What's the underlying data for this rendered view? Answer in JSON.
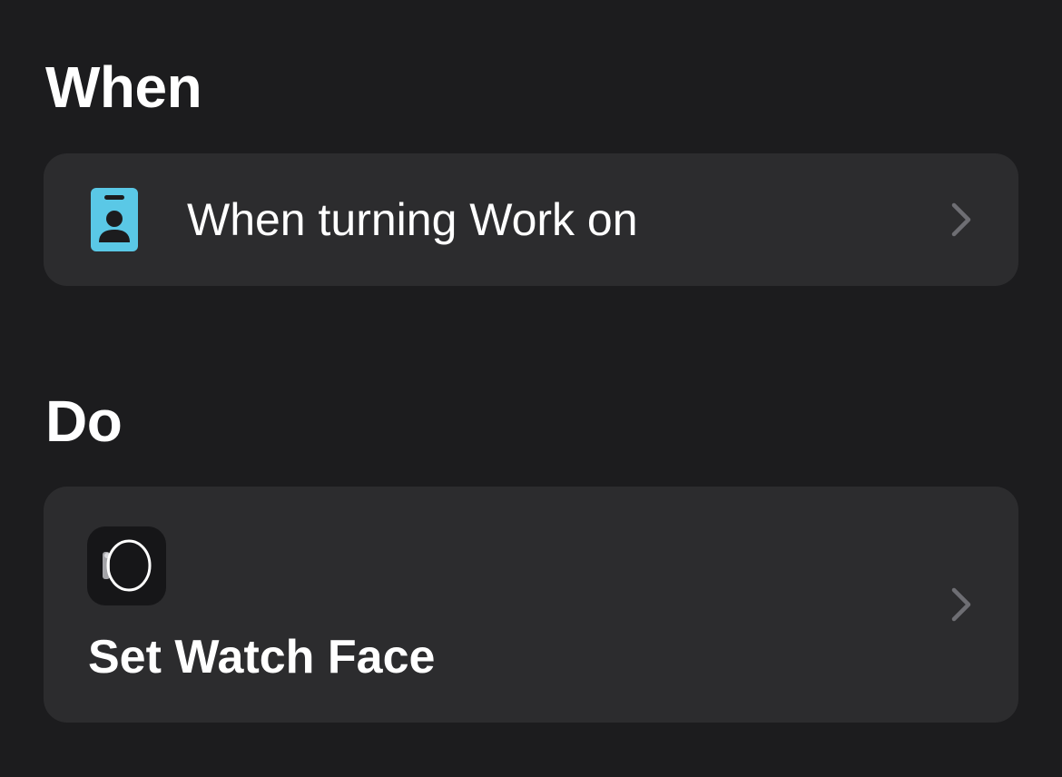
{
  "sections": {
    "when_title": "When",
    "do_title": "Do"
  },
  "trigger": {
    "label": "When turning Work on",
    "icon": "focus-work-badge-icon",
    "icon_color": "#5ac8e6"
  },
  "action": {
    "label": "Set Watch Face",
    "icon": "apple-watch-icon"
  },
  "colors": {
    "background": "#1c1c1e",
    "card": "#2c2c2e",
    "chevron": "#6e6e73"
  }
}
